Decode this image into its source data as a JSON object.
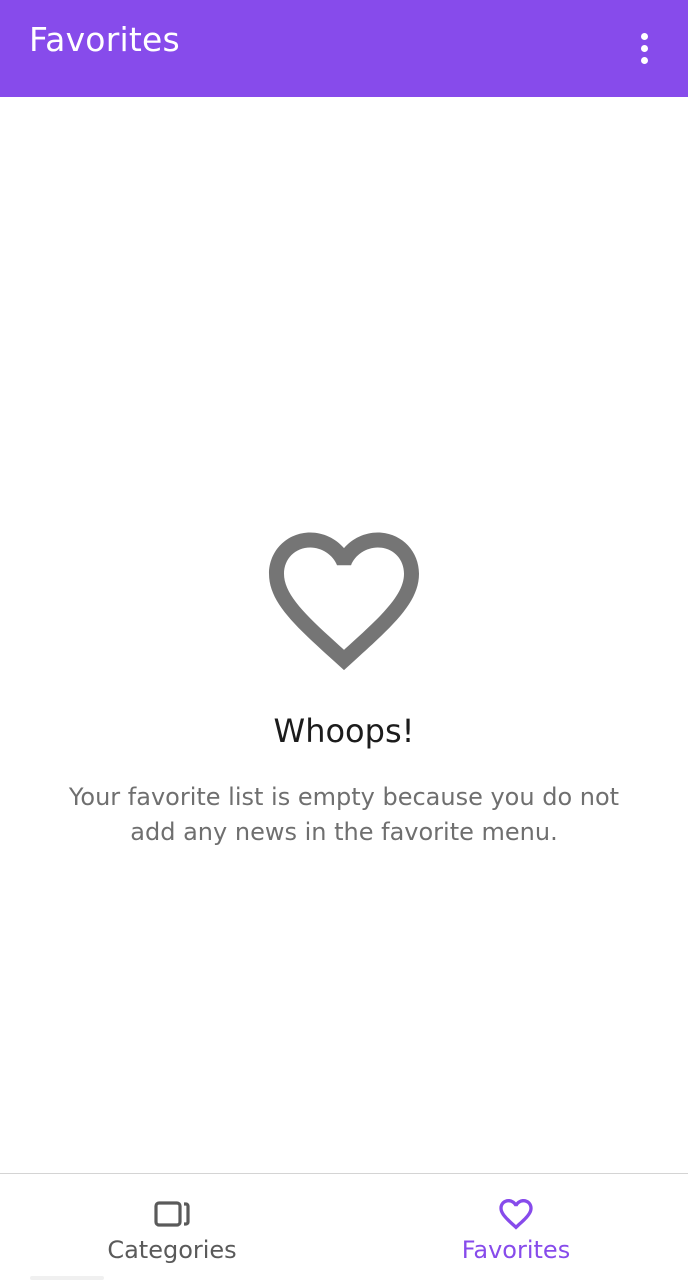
{
  "app_bar": {
    "title": "Favorites",
    "menu_icon": "more-vert-icon",
    "color": "#874beb"
  },
  "empty_state": {
    "icon": "heart-outline-icon",
    "icon_color": "#757575",
    "title": "Whoops!",
    "message": "Your favorite list is empty because you do not add any news in the favorite menu."
  },
  "bottom_nav": {
    "active_color": "#874beb",
    "inactive_color": "#5a5a5a",
    "items": [
      {
        "label": "Categories",
        "icon": "categories-icon",
        "active": false
      },
      {
        "label": "Favorites",
        "icon": "heart-outline-icon",
        "active": true
      }
    ]
  }
}
